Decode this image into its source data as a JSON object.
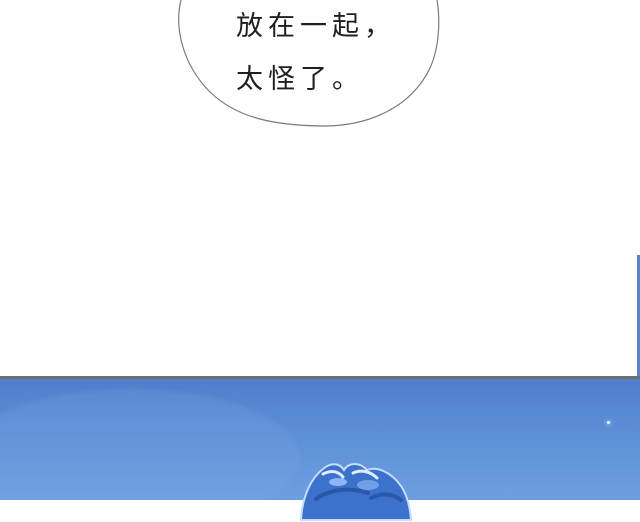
{
  "speech_bubble": {
    "line_1": "放在一起，",
    "line_2": "太怪了。"
  },
  "colors": {
    "bubble_outline": "#7a7a7a",
    "sky_blue": "#5d8fd7",
    "character_hair_blue": "#3c72cb",
    "character_hair_outline": "#c6ddff"
  }
}
